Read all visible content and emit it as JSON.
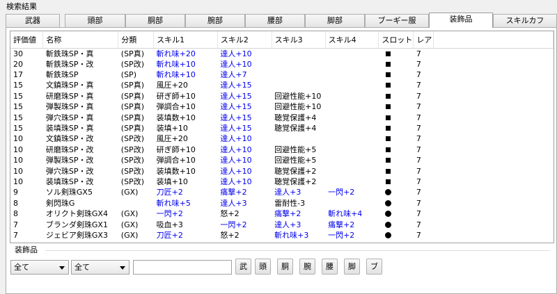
{
  "group_title": "検索結果",
  "tabs": [
    {
      "label": "武器"
    },
    {
      "label": "頭部"
    },
    {
      "label": "胴部"
    },
    {
      "label": "腕部"
    },
    {
      "label": "腰部"
    },
    {
      "label": "脚部"
    },
    {
      "label": "ブーギー服"
    },
    {
      "label": "装飾品",
      "active": true
    },
    {
      "label": "スキルカフ"
    }
  ],
  "columns": [
    "評価値",
    "名称",
    "分類",
    "スキル1",
    "スキル2",
    "スキル3",
    "スキル4",
    "スロット",
    "レア"
  ],
  "rows": [
    {
      "score": "30",
      "name": "斬鉄珠SP・真",
      "cls": "(SP真)",
      "s1": "斬れ味+20",
      "s1b": true,
      "s2": "達人+10",
      "s2b": true,
      "s3": "",
      "s3b": false,
      "s4": "",
      "s4b": false,
      "slot": "square",
      "rare": "7"
    },
    {
      "score": "20",
      "name": "斬鉄珠SP・改",
      "cls": "(SP改)",
      "s1": "斬れ味+10",
      "s1b": true,
      "s2": "達人+10",
      "s2b": true,
      "s3": "",
      "s3b": false,
      "s4": "",
      "s4b": false,
      "slot": "square",
      "rare": "7"
    },
    {
      "score": "17",
      "name": "斬鉄珠SP",
      "cls": "(SP)",
      "s1": "斬れ味+10",
      "s1b": true,
      "s2": "達人+7",
      "s2b": true,
      "s3": "",
      "s3b": false,
      "s4": "",
      "s4b": false,
      "slot": "square",
      "rare": "7"
    },
    {
      "score": "15",
      "name": "文鎮珠SP・真",
      "cls": "(SP真)",
      "s1": "風圧+20",
      "s1b": false,
      "s2": "達人+15",
      "s2b": true,
      "s3": "",
      "s3b": false,
      "s4": "",
      "s4b": false,
      "slot": "square",
      "rare": "7"
    },
    {
      "score": "15",
      "name": "研磨珠SP・真",
      "cls": "(SP真)",
      "s1": "研ぎ師+10",
      "s1b": false,
      "s2": "達人+15",
      "s2b": true,
      "s3": "回避性能+10",
      "s3b": false,
      "s4": "",
      "s4b": false,
      "slot": "square",
      "rare": "7"
    },
    {
      "score": "15",
      "name": "弾製珠SP・真",
      "cls": "(SP真)",
      "s1": "弾調合+10",
      "s1b": false,
      "s2": "達人+15",
      "s2b": true,
      "s3": "回避性能+10",
      "s3b": false,
      "s4": "",
      "s4b": false,
      "slot": "square",
      "rare": "7"
    },
    {
      "score": "15",
      "name": "弾穴珠SP・真",
      "cls": "(SP真)",
      "s1": "装填数+10",
      "s1b": false,
      "s2": "達人+15",
      "s2b": true,
      "s3": "聴覚保護+4",
      "s3b": false,
      "s4": "",
      "s4b": false,
      "slot": "square",
      "rare": "7"
    },
    {
      "score": "15",
      "name": "装填珠SP・真",
      "cls": "(SP真)",
      "s1": "装填+10",
      "s1b": false,
      "s2": "達人+15",
      "s2b": true,
      "s3": "聴覚保護+4",
      "s3b": false,
      "s4": "",
      "s4b": false,
      "slot": "square",
      "rare": "7"
    },
    {
      "score": "10",
      "name": "文鎮珠SP・改",
      "cls": "(SP改)",
      "s1": "風圧+20",
      "s1b": false,
      "s2": "達人+10",
      "s2b": true,
      "s3": "",
      "s3b": false,
      "s4": "",
      "s4b": false,
      "slot": "square",
      "rare": "7"
    },
    {
      "score": "10",
      "name": "研磨珠SP・改",
      "cls": "(SP改)",
      "s1": "研ぎ師+10",
      "s1b": false,
      "s2": "達人+10",
      "s2b": true,
      "s3": "回避性能+5",
      "s3b": false,
      "s4": "",
      "s4b": false,
      "slot": "square",
      "rare": "7"
    },
    {
      "score": "10",
      "name": "弾製珠SP・改",
      "cls": "(SP改)",
      "s1": "弾調合+10",
      "s1b": false,
      "s2": "達人+10",
      "s2b": true,
      "s3": "回避性能+5",
      "s3b": false,
      "s4": "",
      "s4b": false,
      "slot": "square",
      "rare": "7"
    },
    {
      "score": "10",
      "name": "弾穴珠SP・改",
      "cls": "(SP改)",
      "s1": "装填数+10",
      "s1b": false,
      "s2": "達人+10",
      "s2b": true,
      "s3": "聴覚保護+2",
      "s3b": false,
      "s4": "",
      "s4b": false,
      "slot": "square",
      "rare": "7"
    },
    {
      "score": "10",
      "name": "装填珠SP・改",
      "cls": "(SP改)",
      "s1": "装填+10",
      "s1b": false,
      "s2": "達人+10",
      "s2b": true,
      "s3": "聴覚保護+2",
      "s3b": false,
      "s4": "",
      "s4b": false,
      "slot": "square",
      "rare": "7"
    },
    {
      "score": "9",
      "name": "ソル剣珠GX5",
      "cls": "(GX)",
      "s1": "刀匠+2",
      "s1b": true,
      "s2": "痛撃+2",
      "s2b": true,
      "s3": "達人+3",
      "s3b": true,
      "s4": "一閃+2",
      "s4b": true,
      "slot": "circle",
      "rare": "7"
    },
    {
      "score": "8",
      "name": "剣閃珠G",
      "cls": "",
      "s1": "斬れ味+5",
      "s1b": true,
      "s2": "達人+3",
      "s2b": true,
      "s3": "雷耐性-3",
      "s3b": false,
      "s4": "",
      "s4b": false,
      "slot": "circle",
      "rare": "7"
    },
    {
      "score": "8",
      "name": "オリクト剣珠GX4",
      "cls": "(GX)",
      "s1": "一閃+2",
      "s1b": true,
      "s2": "怒+2",
      "s2b": false,
      "s3": "痛撃+2",
      "s3b": true,
      "s4": "斬れ味+4",
      "s4b": true,
      "slot": "circle",
      "rare": "7"
    },
    {
      "score": "7",
      "name": "ブランダ剣珠GX1",
      "cls": "(GX)",
      "s1": "吸血+3",
      "s1b": false,
      "s2": "一閃+2",
      "s2b": true,
      "s3": "達人+3",
      "s3b": true,
      "s4": "痛撃+2",
      "s4b": true,
      "slot": "circle",
      "rare": "7"
    },
    {
      "score": "7",
      "name": "ジェビア剣珠GX3",
      "cls": "(GX)",
      "s1": "刀匠+2",
      "s1b": true,
      "s2": "怒+2",
      "s2b": false,
      "s3": "斬れ味+3",
      "s3b": true,
      "s4": "一閃+2",
      "s4b": true,
      "slot": "circle",
      "rare": "7"
    }
  ],
  "filter": {
    "title": "装飾品",
    "select1": "全て",
    "select2": "全て",
    "search_value": "",
    "buttons": [
      "武",
      "頭",
      "胴",
      "腕",
      "腰",
      "脚",
      "ブ"
    ]
  }
}
